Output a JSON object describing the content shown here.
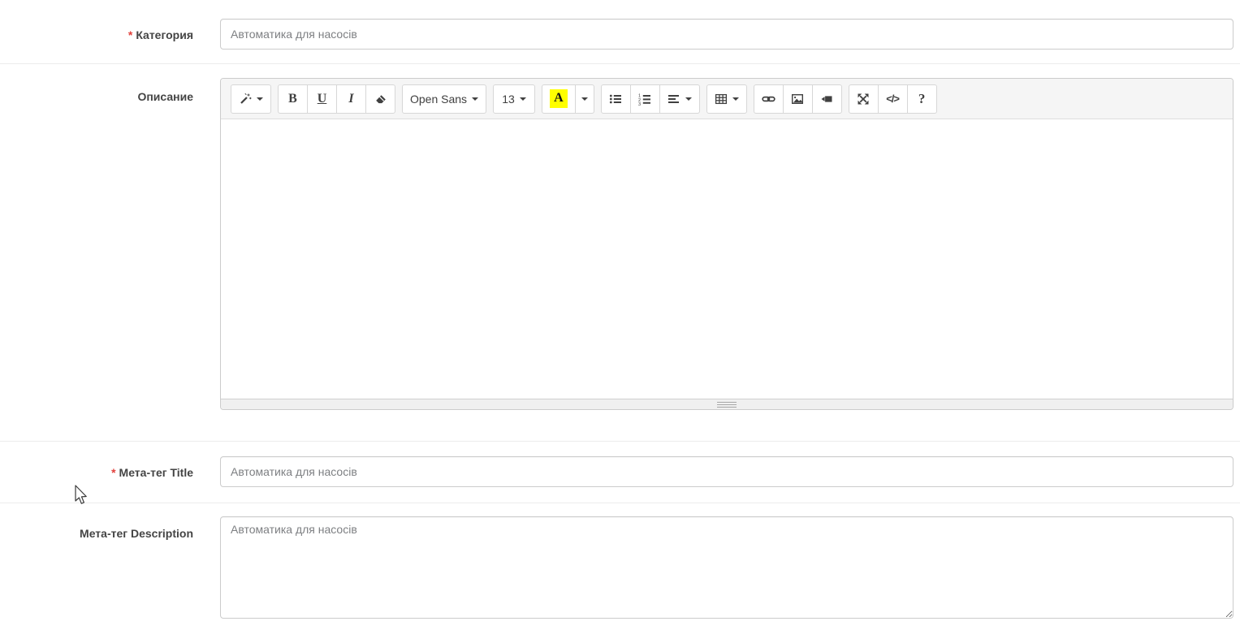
{
  "form": {
    "required_marker": "*",
    "category": {
      "label": "Категория",
      "required": true,
      "value": "Автоматика для насосів"
    },
    "description": {
      "label": "Описание",
      "required": false
    },
    "meta_title": {
      "label": "Мета-тег Title",
      "required": true,
      "value": "Автоматика для насосів"
    },
    "meta_description": {
      "label": "Мета-тег Description",
      "required": false,
      "value": "Автоматика для насосів"
    }
  },
  "editor": {
    "content": "",
    "toolbar": {
      "bold_letter": "B",
      "underline_letter": "U",
      "italic_letter": "I",
      "fontname_label": "Open Sans",
      "fontsize_label": "13",
      "color_letter": "A",
      "color_highlight": "#ffff00",
      "codeview_label": "</>",
      "help_label": "?",
      "icons": [
        "magic-wand-icon",
        "bold-icon",
        "underline-icon",
        "italic-icon",
        "eraser-icon",
        "font-color-icon",
        "unordered-list-icon",
        "ordered-list-icon",
        "paragraph-align-icon",
        "table-icon",
        "link-icon",
        "picture-icon",
        "video-icon",
        "fullscreen-icon",
        "code-view-icon",
        "help-icon"
      ]
    }
  },
  "colors": {
    "required_star": "#e2413c",
    "toolbar_background": "#f5f5f5",
    "control_border": "#cccccc",
    "label_text": "#444444",
    "input_text": "#7d7f82"
  }
}
